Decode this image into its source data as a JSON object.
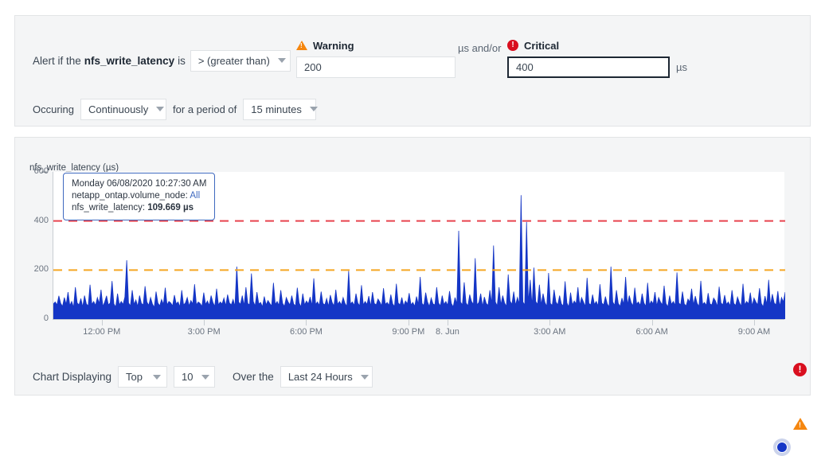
{
  "alert_config": {
    "prefix_text": "Alert if the",
    "metric_name": "nfs_write_latency",
    "is_text": "is",
    "operator": "> (greater than)",
    "occurring_label": "Occuring",
    "occurrence": "Continuously",
    "period_label": "for a period of",
    "period": "15 minutes",
    "warning": {
      "label": "Warning",
      "icon": "warning-triangle-icon",
      "value": "200",
      "unit": "µs",
      "color": "#f5860f"
    },
    "and_or_text": "µs and/or",
    "critical": {
      "label": "Critical",
      "icon": "critical-circle-icon",
      "value": "400",
      "unit": "µs",
      "color": "#d90f1f"
    }
  },
  "chart_panel": {
    "title": "nfs_write_latency (µs)",
    "tooltip": {
      "timestamp": "Monday 06/08/2020 10:27:30 AM",
      "node_label": "netapp_ontap.volume_node:",
      "node_value": "All",
      "metric_label": "nfs_write_latency:",
      "metric_value": "109.669 µs"
    },
    "controls": {
      "displaying_label": "Chart Displaying",
      "rank": "Top",
      "count": "10",
      "over_the_label": "Over the",
      "range": "Last 24 Hours"
    }
  },
  "chart_data": {
    "type": "area",
    "title": "nfs_write_latency (µs)",
    "xlabel": "",
    "ylabel": "nfs_write_latency (µs)",
    "series_name": "nfs_write_latency",
    "series_color": "#1536c6",
    "ylim": [
      0,
      600
    ],
    "yticks": [
      0,
      200,
      400,
      600
    ],
    "grid": false,
    "legend": "none",
    "xtick_labels": [
      "12:00 PM",
      "3:00 PM",
      "6:00 PM",
      "9:00 PM",
      "8. Jun",
      "3:00 AM",
      "6:00 AM",
      "9:00 AM"
    ],
    "xtick_positions": [
      78,
      240,
      402,
      564,
      626,
      788,
      950,
      1112
    ],
    "thresholds": [
      {
        "name": "Critical",
        "value": 400,
        "color": "#e8444f",
        "style": "dashed",
        "marker": "critical-circle-icon"
      },
      {
        "name": "Warning",
        "value": 200,
        "color": "#f5a623",
        "style": "dashed",
        "marker": "warning-triangle-icon"
      }
    ],
    "hover_point": {
      "x_label": "Monday 06/08/2020 10:27:30 AM",
      "y": 109.669,
      "unit": "µs"
    },
    "values": [
      62,
      70,
      58,
      95,
      64,
      52,
      88,
      60,
      110,
      55,
      72,
      48,
      130,
      66,
      58,
      84,
      50,
      96,
      62,
      54,
      140,
      60,
      72,
      56,
      88,
      64,
      120,
      52,
      70,
      95,
      58,
      66,
      155,
      62,
      50,
      104,
      58,
      72,
      60,
      90,
      240,
      66,
      54,
      118,
      60,
      78,
      52,
      96,
      64,
      58,
      134,
      70,
      56,
      88,
      62,
      48,
      112,
      66,
      54,
      80,
      60,
      128,
      58,
      72,
      66,
      54,
      98,
      62,
      70,
      50,
      118,
      58,
      66,
      88,
      54,
      76,
      62,
      142,
      58,
      70,
      64,
      52,
      108,
      60,
      74,
      56,
      96,
      68,
      52,
      124,
      58,
      70,
      62,
      86,
      54,
      100,
      66,
      58,
      80,
      52,
      214,
      70,
      60,
      96,
      55,
      130,
      64,
      58,
      186,
      72,
      54,
      110,
      62,
      68,
      50,
      92,
      58,
      76,
      64,
      54,
      148,
      60,
      72,
      56,
      118,
      64,
      52,
      88,
      70,
      58,
      96,
      62,
      54,
      128,
      66,
      50,
      104,
      58,
      74,
      62,
      90,
      54,
      166,
      60,
      70,
      56,
      112,
      64,
      58,
      84,
      52,
      98,
      68,
      54,
      120,
      60,
      72,
      58,
      88,
      64,
      52,
      196,
      62,
      70,
      56,
      104,
      66,
      54,
      138,
      58,
      72,
      60,
      94,
      52,
      110,
      64,
      58,
      82,
      70,
      54,
      126,
      60,
      68,
      56,
      100,
      62,
      52,
      144,
      66,
      58,
      88,
      54,
      74,
      62,
      106,
      58,
      68,
      52,
      92,
      60,
      172,
      64,
      56,
      108,
      70,
      52,
      86,
      62,
      58,
      130,
      66,
      54,
      96,
      60,
      72,
      56,
      114,
      64,
      50,
      88,
      62,
      360,
      70,
      58,
      150,
      66,
      54,
      100,
      72,
      60,
      248,
      58,
      68,
      104,
      52,
      90,
      64,
      56,
      118,
      62,
      300,
      70,
      54,
      130,
      58,
      96,
      66,
      52,
      182,
      74,
      60,
      112,
      56,
      88,
      62,
      505,
      70,
      58,
      396,
      66,
      160,
      54,
      210,
      72,
      60,
      140,
      58,
      104,
      68,
      52,
      188,
      64,
      56,
      120,
      70,
      58,
      96,
      62,
      54,
      154,
      66,
      50,
      108,
      58,
      74,
      62,
      130,
      56,
      88,
      70,
      52,
      168,
      64,
      58,
      100,
      60,
      72,
      54,
      142,
      66,
      58,
      92,
      62,
      50,
      214,
      70,
      56,
      118,
      64,
      52,
      86,
      60,
      172,
      58,
      96,
      68,
      54,
      128,
      62,
      70,
      56,
      104,
      66,
      52,
      148,
      58,
      74,
      62,
      110,
      54,
      88,
      70,
      58,
      136,
      64,
      50,
      96,
      60,
      72,
      56,
      190,
      66,
      58,
      112,
      62,
      54,
      82,
      70,
      124,
      58,
      94,
      64,
      52,
      156,
      60,
      68,
      56,
      106,
      62,
      58,
      86,
      74,
      52,
      132,
      66,
      58,
      98,
      60,
      70,
      54,
      118,
      64,
      56,
      90,
      68,
      52,
      144,
      58,
      72,
      62,
      108,
      54,
      86,
      70,
      58,
      126,
      64,
      50,
      94,
      60,
      160,
      56,
      102,
      66,
      58,
      114,
      52,
      88,
      70,
      110
    ]
  }
}
